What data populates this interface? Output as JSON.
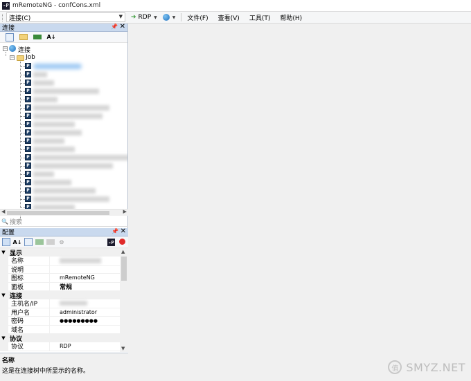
{
  "window": {
    "title": "mRemoteNG - confCons.xml",
    "logo_text": "-P"
  },
  "menubar": {
    "connections_combo": "连接(C)",
    "protocol": "RDP",
    "menus": [
      "文件(F)",
      "查看(V)",
      "工具(T)",
      "帮助(H)"
    ]
  },
  "connections_panel": {
    "title": "连接",
    "tree": {
      "root": "连接",
      "folder": "Job",
      "node_icon_text": "P"
    },
    "search_placeholder": "搜索"
  },
  "config_panel": {
    "title": "配置",
    "categories": {
      "display": "显示",
      "connection": "连接",
      "protocol": "协议"
    },
    "props": {
      "name_label": "名称",
      "desc_label": "说明",
      "icon_label": "图标",
      "icon_value": "mRemoteNG",
      "panel_label": "面板",
      "panel_value": "常规",
      "host_label": "主机名/IP",
      "user_label": "用户名",
      "user_value": "administrator",
      "pass_label": "密码",
      "pass_value": "●●●●●●●●●",
      "domain_label": "域名",
      "proto_label": "协议",
      "proto_value": "RDP"
    },
    "description": {
      "title": "名称",
      "text": "这是在连接树中所显示的名称。"
    }
  },
  "watermark": {
    "text": "SMYZ.NET",
    "glyph": "值"
  }
}
